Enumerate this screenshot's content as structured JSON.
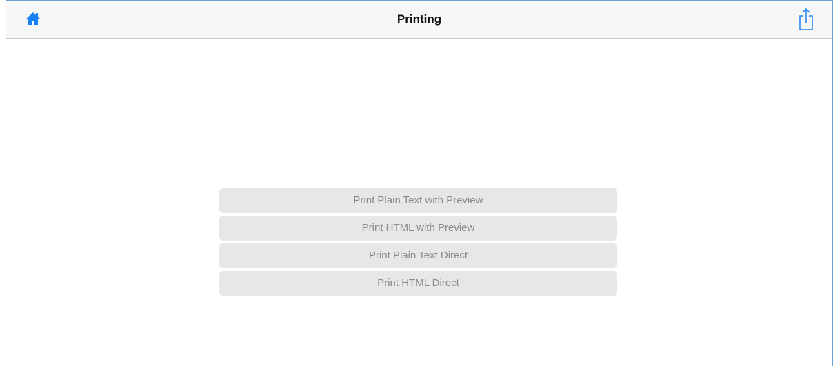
{
  "navbar": {
    "title": "Printing",
    "home_icon": "home-icon",
    "share_icon": "share-icon",
    "accent_color": "#1a82f7"
  },
  "actions": [
    {
      "label": "Print Plain Text with Preview"
    },
    {
      "label": "Print HTML with Preview"
    },
    {
      "label": "Print Plain Text Direct"
    },
    {
      "label": "Print HTML Direct"
    }
  ]
}
